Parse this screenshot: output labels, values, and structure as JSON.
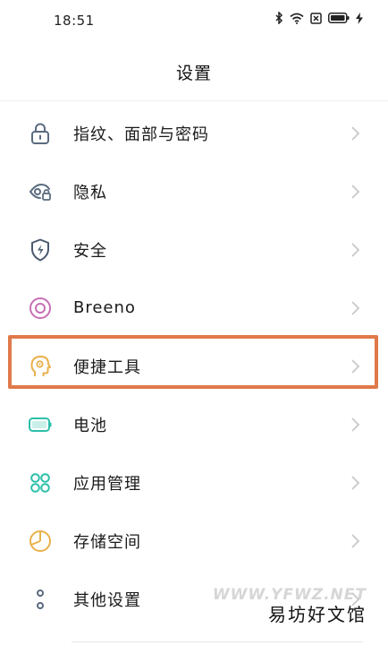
{
  "status_bar": {
    "time": "18:51",
    "icons": [
      "bluetooth-icon",
      "wifi-icon",
      "sim-card-icon",
      "battery-icon",
      "charging-icon"
    ]
  },
  "header": {
    "title": "设置"
  },
  "settings": [
    {
      "label": "指纹、面部与密码",
      "icon": "lock-icon",
      "color": "#5a6b80"
    },
    {
      "label": "隐私",
      "icon": "privacy-eye-icon",
      "color": "#5a6b80"
    },
    {
      "label": "安全",
      "icon": "shield-icon",
      "color": "#4a5a70"
    },
    {
      "label": "Breeno",
      "icon": "breeno-icon",
      "color": "#c86fb5"
    },
    {
      "label": "便捷工具",
      "icon": "convenience-tools-icon",
      "color": "#e8b04a"
    },
    {
      "label": "电池",
      "icon": "battery-icon",
      "color": "#2bbfa8"
    },
    {
      "label": "应用管理",
      "icon": "apps-grid-icon",
      "color": "#2bbfa8"
    },
    {
      "label": "存储空间",
      "icon": "storage-pie-icon",
      "color": "#e8b04a"
    },
    {
      "label": "其他设置",
      "icon": "more-settings-icon",
      "color": "#5a6b80"
    }
  ],
  "highlight": {
    "color": "#e0794a",
    "target": "便捷工具"
  },
  "watermark": {
    "domain": "WWW.YFWZ.NET",
    "name": "易坊好文馆"
  }
}
